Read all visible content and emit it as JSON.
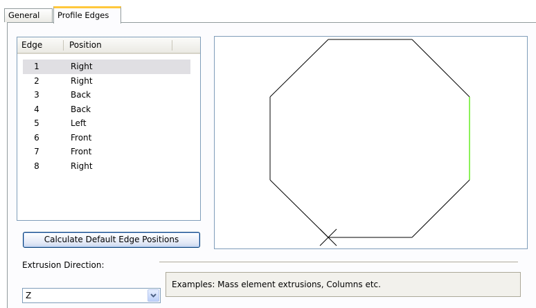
{
  "tabs": [
    {
      "label": "General",
      "active": false
    },
    {
      "label": "Profile Edges",
      "active": true
    }
  ],
  "edge_list": {
    "columns": {
      "edge": "Edge",
      "position": "Position"
    },
    "rows": [
      {
        "edge": "1",
        "position": "Right",
        "selected": true
      },
      {
        "edge": "2",
        "position": "Right"
      },
      {
        "edge": "3",
        "position": "Back"
      },
      {
        "edge": "4",
        "position": "Back"
      },
      {
        "edge": "5",
        "position": "Left"
      },
      {
        "edge": "6",
        "position": "Front"
      },
      {
        "edge": "7",
        "position": "Front"
      },
      {
        "edge": "8",
        "position": "Right"
      }
    ]
  },
  "calculate_button": "Calculate Default Edge Positions",
  "extrusion": {
    "label": "Extrusion Direction:",
    "value": "Z",
    "examples": "Examples: Mass element extrusions, Columns etc."
  },
  "colors": {
    "highlight_edge": "#66ee22",
    "selected_row": "#e0dfe3",
    "tab_accent": "#ffc83c"
  }
}
